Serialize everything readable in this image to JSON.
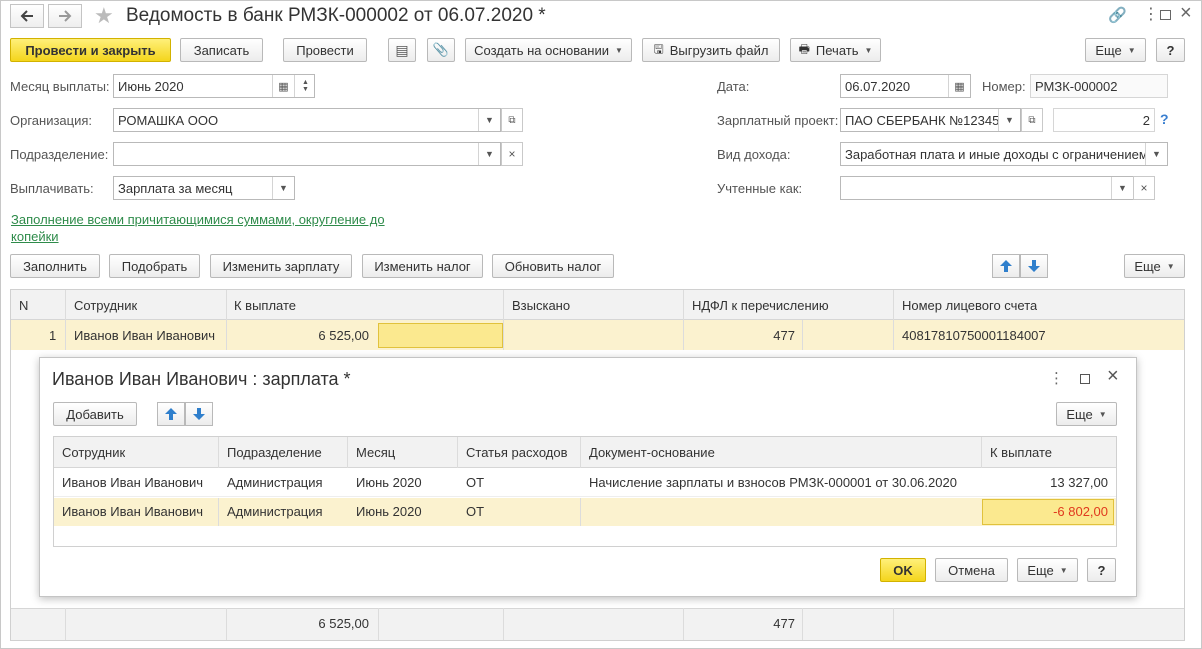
{
  "window": {
    "title": "Ведомость в банк РМЗК-000002 от 06.07.2020 *"
  },
  "toolbar": {
    "post_close": "Провести и закрыть",
    "write": "Записать",
    "post": "Провести",
    "create_based": "Создать на основании",
    "export_file": "Выгрузить файл",
    "print": "Печать",
    "more": "Еще",
    "help": "?"
  },
  "form": {
    "month_label": "Месяц выплаты:",
    "month_value": "Июнь 2020",
    "org_label": "Организация:",
    "org_value": "РОМАШКА ООО",
    "dept_label": "Подразделение:",
    "dept_value": "",
    "pay_label": "Выплачивать:",
    "pay_value": "Зарплата за месяц",
    "date_label": "Дата:",
    "date_value": "06.07.2020",
    "number_label": "Номер:",
    "number_value": "РМЗК-000002",
    "project_label": "Зарплатный проект:",
    "project_value": "ПАО СБЕРБАНК №12345",
    "project_count": "2",
    "income_label": "Вид дохода:",
    "income_value": "Заработная плата и иные доходы с ограничением",
    "accounted_label": "Учтенные как:",
    "accounted_value": "",
    "fill_link_line1": "Заполнение всеми причитающимися суммами, округление до",
    "fill_link_line2": "копейки"
  },
  "table_toolbar": {
    "fill": "Заполнить",
    "pick": "Подобрать",
    "change_salary": "Изменить зарплату",
    "change_tax": "Изменить налог",
    "update_tax": "Обновить налог",
    "more": "Еще"
  },
  "table": {
    "headers": [
      "N",
      "Сотрудник",
      "К выплате",
      "Взыскано",
      "НДФЛ к перечислению",
      "Номер лицевого счета"
    ],
    "rows": [
      {
        "n": "1",
        "employee": "Иванов Иван Иванович",
        "to_pay": "6 525,00",
        "collected": "",
        "ndfl": "477",
        "account": "40817810750001184007"
      }
    ],
    "totals": {
      "to_pay": "6 525,00",
      "ndfl": "477"
    }
  },
  "dialog": {
    "title": "Иванов Иван Иванович : зарплата *",
    "add": "Добавить",
    "more": "Еще",
    "headers": [
      "Сотрудник",
      "Подразделение",
      "Месяц",
      "Статья расходов",
      "Документ-основание",
      "К выплате"
    ],
    "rows": [
      {
        "employee": "Иванов Иван Иванович",
        "dept": "Администрация",
        "month": "Июнь 2020",
        "article": "ОТ",
        "doc": "Начисление зарплаты и взносов РМЗК-000001 от 30.06.2020",
        "amount": "13 327,00"
      },
      {
        "employee": "Иванов Иван Иванович",
        "dept": "Администрация",
        "month": "Июнь 2020",
        "article": "ОТ",
        "doc": "",
        "amount": "-6 802,00"
      }
    ],
    "ok": "OK",
    "cancel": "Отмена",
    "more_bottom": "Еще",
    "help": "?"
  },
  "colors": {
    "accent_yellow": "#f4d51c",
    "selected_row": "#fbf2cf",
    "link_green": "#2e8b4a",
    "negative_red": "#e03a1e"
  }
}
